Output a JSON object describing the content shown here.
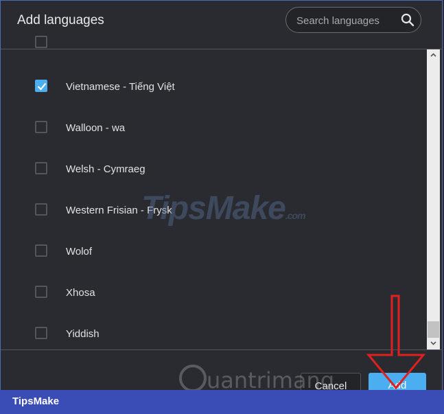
{
  "dialog": {
    "title": "Add languages",
    "search": {
      "placeholder": "Search languages"
    }
  },
  "languages": [
    {
      "label": "Vietnamese - Tiếng Việt",
      "checked": true
    },
    {
      "label": "Walloon - wa",
      "checked": false
    },
    {
      "label": "Welsh - Cymraeg",
      "checked": false
    },
    {
      "label": "Western Frisian - Frysk",
      "checked": false
    },
    {
      "label": "Wolof",
      "checked": false
    },
    {
      "label": "Xhosa",
      "checked": false
    },
    {
      "label": "Yiddish",
      "checked": false
    }
  ],
  "footer": {
    "cancel_label": "Cancel",
    "add_label": "Add"
  },
  "watermarks": {
    "main": "TipsMake",
    "main_suffix": ".com",
    "secondary": "uantrimang"
  },
  "banner": {
    "text": "TipsMake"
  },
  "colors": {
    "accent": "#4aaef0",
    "background": "#2a2b30",
    "banner": "#3a4cb6",
    "annotation_arrow": "#e02020"
  },
  "icons": {
    "search": "search-icon",
    "check": "check-icon",
    "scroll_up": "chevron-up-icon",
    "scroll_down": "chevron-down-icon"
  }
}
